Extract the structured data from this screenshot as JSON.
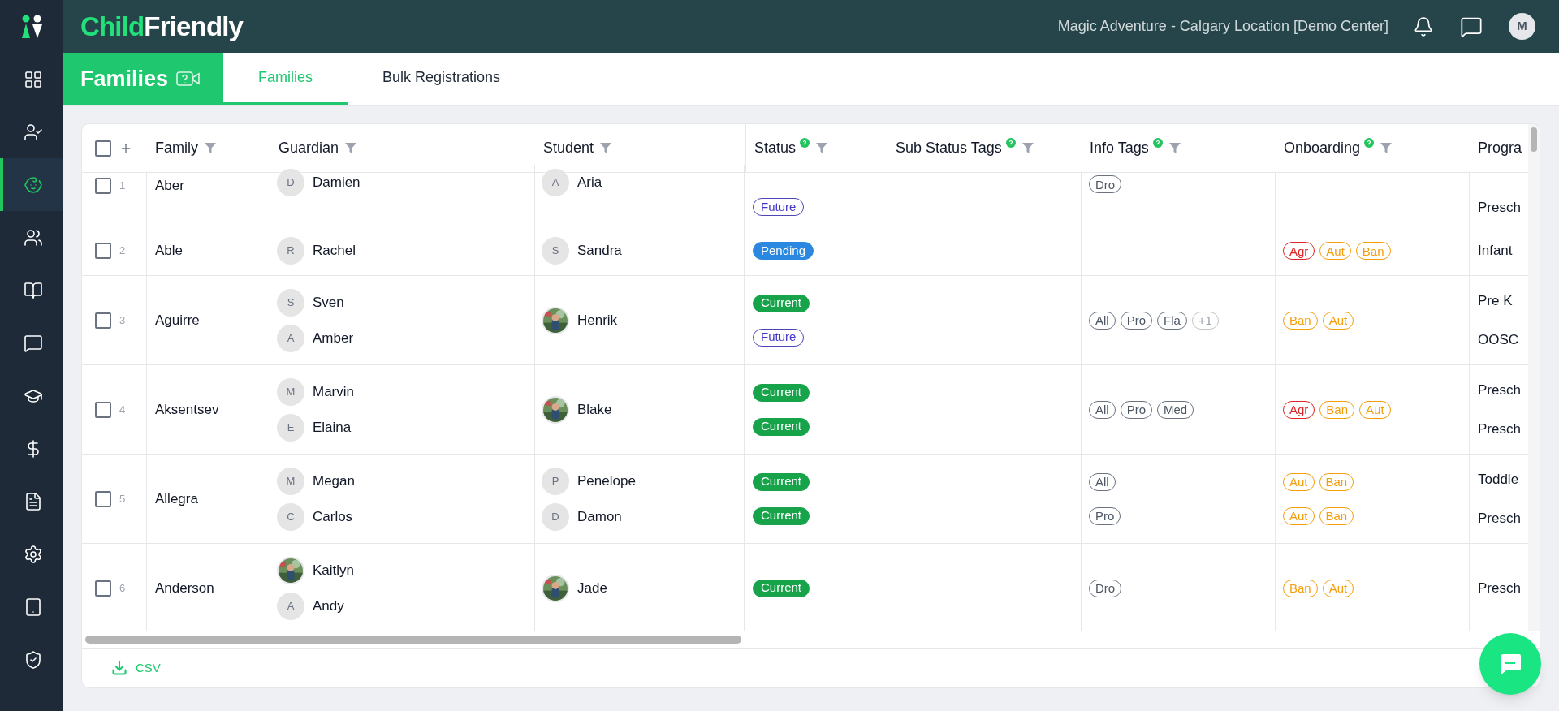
{
  "sidebar": {
    "items": [
      {
        "selected": false
      },
      {
        "selected": false
      },
      {
        "selected": true
      },
      {
        "selected": false
      },
      {
        "selected": false
      },
      {
        "selected": false
      },
      {
        "selected": false
      },
      {
        "selected": false
      },
      {
        "selected": false
      },
      {
        "selected": false
      },
      {
        "selected": false
      },
      {
        "selected": false
      }
    ]
  },
  "topbar": {
    "logo": {
      "accent": "Child",
      "rest": "Friendly"
    },
    "location": "Magic Adventure - Calgary Location [Demo Center]",
    "user_initial": "M"
  },
  "page_title": "Families",
  "tabs": [
    {
      "label": "Families",
      "selected": true
    },
    {
      "label": "Bulk Registrations",
      "selected": false
    }
  ],
  "table": {
    "select_all_checked": false,
    "columns": [
      {
        "label": "Family",
        "help": false,
        "filter": true
      },
      {
        "label": "Guardian",
        "help": false,
        "filter": true
      },
      {
        "label": "Student",
        "help": false,
        "filter": true
      },
      {
        "label": "Status",
        "help": true,
        "filter": true
      },
      {
        "label": "Sub Status Tags",
        "help": true,
        "filter": true
      },
      {
        "label": "Info Tags",
        "help": true,
        "filter": true
      },
      {
        "label": "Onboarding",
        "help": true,
        "filter": true
      },
      {
        "label": "Progra",
        "help": false,
        "filter": false
      }
    ],
    "rows": [
      {
        "number": "1",
        "checked": false,
        "family": "Aber",
        "guardians": [
          {
            "name": "Damien",
            "initial": "D",
            "kind": "initial"
          }
        ],
        "students": [
          {
            "name": "Aria",
            "initial": "A",
            "kind": "initial"
          }
        ],
        "statuses": [
          {
            "label": "Future",
            "kind": "future"
          }
        ],
        "info_tags": [
          [
            {
              "label": "Dro",
              "kind": "tag"
            }
          ]
        ],
        "onboarding": [],
        "programs": [
          "Presch"
        ]
      },
      {
        "number": "2",
        "checked": false,
        "family": "Able",
        "guardians": [
          {
            "name": "Rachel",
            "initial": "R",
            "kind": "initial"
          }
        ],
        "students": [
          {
            "name": "Sandra",
            "initial": "S",
            "kind": "initial"
          }
        ],
        "statuses": [
          {
            "label": "Pending",
            "kind": "pending"
          }
        ],
        "info_tags": [],
        "onboarding": [
          [
            {
              "label": "Agr",
              "kind": "alert"
            },
            {
              "label": "Aut",
              "kind": "warn"
            },
            {
              "label": "Ban",
              "kind": "warn"
            }
          ]
        ],
        "programs": [
          "Infant"
        ]
      },
      {
        "number": "3",
        "checked": false,
        "family": "Aguirre",
        "guardians": [
          {
            "name": "Sven",
            "initial": "S",
            "kind": "initial"
          },
          {
            "name": "Amber",
            "initial": "A",
            "kind": "initial"
          }
        ],
        "students": [
          {
            "name": "Henrik"
          }
        ],
        "statuses": [
          {
            "label": "Current",
            "kind": "current"
          },
          {
            "label": "Future",
            "kind": "future"
          }
        ],
        "info_tags": [
          [
            {
              "label": "All",
              "kind": "tag"
            },
            {
              "label": "Pro",
              "kind": "tag"
            },
            {
              "label": "Fla",
              "kind": "tag"
            },
            {
              "label": "+1",
              "kind": "more"
            }
          ]
        ],
        "onboarding": [
          [
            {
              "label": "Ban",
              "kind": "warn"
            },
            {
              "label": "Aut",
              "kind": "warn"
            }
          ]
        ],
        "programs": [
          "Pre K",
          "OOSC"
        ]
      },
      {
        "number": "4",
        "checked": false,
        "family": "Aksentsev",
        "guardians": [
          {
            "name": "Marvin",
            "initial": "M",
            "kind": "initial"
          },
          {
            "name": "Elaina",
            "initial": "E",
            "kind": "initial"
          }
        ],
        "students": [
          {
            "name": "Blake"
          }
        ],
        "statuses": [
          {
            "label": "Current",
            "kind": "current"
          },
          {
            "label": "Current",
            "kind": "current"
          }
        ],
        "info_tags": [
          [
            {
              "label": "All",
              "kind": "tag"
            },
            {
              "label": "Pro",
              "kind": "tag"
            },
            {
              "label": "Med",
              "kind": "tag"
            }
          ]
        ],
        "onboarding": [
          [
            {
              "label": "Agr",
              "kind": "alert"
            },
            {
              "label": "Ban",
              "kind": "warn"
            },
            {
              "label": "Aut",
              "kind": "warn"
            }
          ]
        ],
        "programs": [
          "Presch",
          "Presch"
        ]
      },
      {
        "number": "5",
        "checked": false,
        "family": "Allegra",
        "guardians": [
          {
            "name": "Megan",
            "initial": "M",
            "kind": "initial"
          },
          {
            "name": "Carlos",
            "initial": "C",
            "kind": "initial"
          }
        ],
        "students": [
          {
            "name": "Penelope",
            "initial": "P",
            "kind": "initial"
          },
          {
            "name": "Damon",
            "initial": "D",
            "kind": "initial"
          }
        ],
        "statuses": [
          {
            "label": "Current",
            "kind": "current"
          },
          {
            "label": "Current",
            "kind": "current"
          }
        ],
        "info_tags": [
          [
            {
              "label": "All",
              "kind": "tag"
            }
          ],
          [
            {
              "label": "Pro",
              "kind": "tag"
            }
          ]
        ],
        "onboarding": [
          [
            {
              "label": "Aut",
              "kind": "warn"
            },
            {
              "label": "Ban",
              "kind": "warn"
            }
          ],
          [
            {
              "label": "Aut",
              "kind": "warn"
            },
            {
              "label": "Ban",
              "kind": "warn"
            }
          ]
        ],
        "programs": [
          "Toddle",
          "Presch"
        ]
      },
      {
        "number": "6",
        "checked": false,
        "family": "Anderson",
        "guardians": [
          {
            "name": "Kaitlyn"
          },
          {
            "name": "Andy",
            "initial": "A",
            "kind": "initial"
          }
        ],
        "students": [
          {
            "name": "Jade"
          }
        ],
        "statuses": [
          {
            "label": "Current",
            "kind": "current"
          }
        ],
        "info_tags": [
          [
            {
              "label": "Dro",
              "kind": "tag"
            }
          ]
        ],
        "onboarding": [
          [
            {
              "label": "Ban",
              "kind": "warn"
            },
            {
              "label": "Aut",
              "kind": "warn"
            }
          ]
        ],
        "programs": [
          "Presch"
        ]
      }
    ]
  },
  "footer": {
    "export": "CSV"
  }
}
